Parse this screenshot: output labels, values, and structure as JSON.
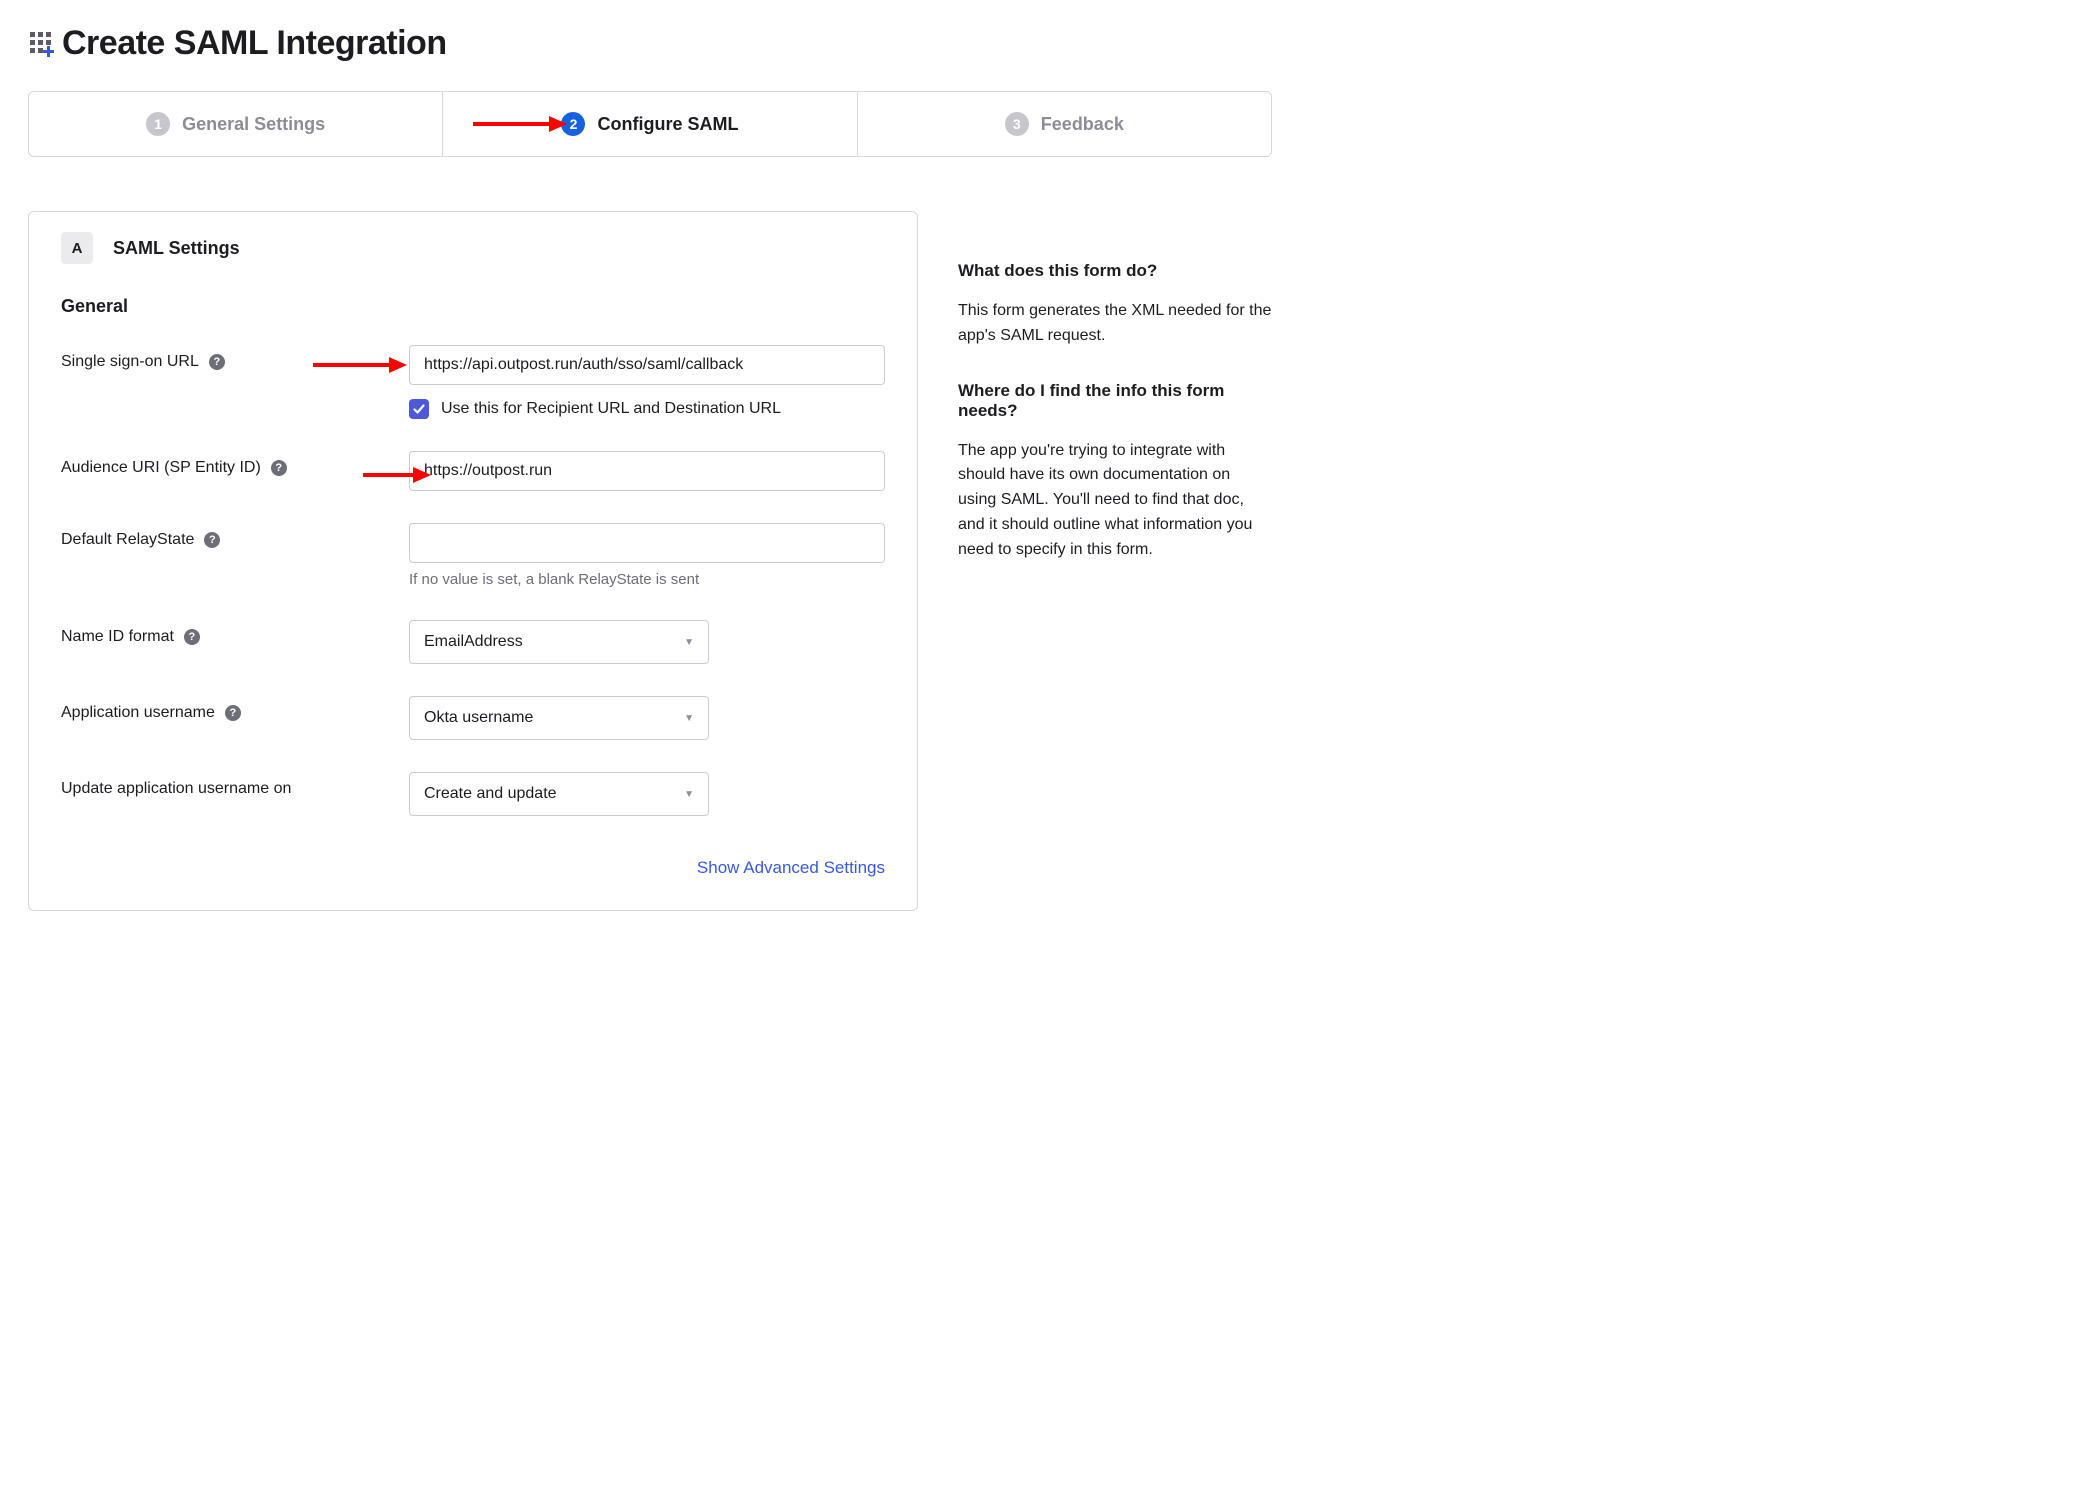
{
  "page_title": "Create SAML Integration",
  "wizard": {
    "steps": [
      {
        "num": "1",
        "label": "General Settings",
        "active": false
      },
      {
        "num": "2",
        "label": "Configure SAML",
        "active": true
      },
      {
        "num": "3",
        "label": "Feedback",
        "active": false
      }
    ]
  },
  "section": {
    "badge": "A",
    "title": "SAML Settings",
    "subsection": "General"
  },
  "fields": {
    "sso_url": {
      "label": "Single sign-on URL",
      "value": "https://api.outpost.run/auth/sso/saml/callback",
      "checkbox_label": "Use this for Recipient URL and Destination URL"
    },
    "audience": {
      "label": "Audience URI (SP Entity ID)",
      "value": "https://outpost.run"
    },
    "relaystate": {
      "label": "Default RelayState",
      "value": "",
      "hint": "If no value is set, a blank RelayState is sent"
    },
    "nameid": {
      "label": "Name ID format",
      "value": "EmailAddress"
    },
    "app_username": {
      "label": "Application username",
      "value": "Okta username"
    },
    "update_on": {
      "label": "Update application username on",
      "value": "Create and update"
    }
  },
  "advanced_link": "Show Advanced Settings",
  "sidebar": {
    "q1_title": "What does this form do?",
    "q1_body": "This form generates the XML needed for the app's SAML request.",
    "q2_title": "Where do I find the info this form needs?",
    "q2_body": "The app you're trying to integrate with should have its own documentation on using SAML. You'll need to find that doc, and it should outline what information you need to specify in this form."
  }
}
